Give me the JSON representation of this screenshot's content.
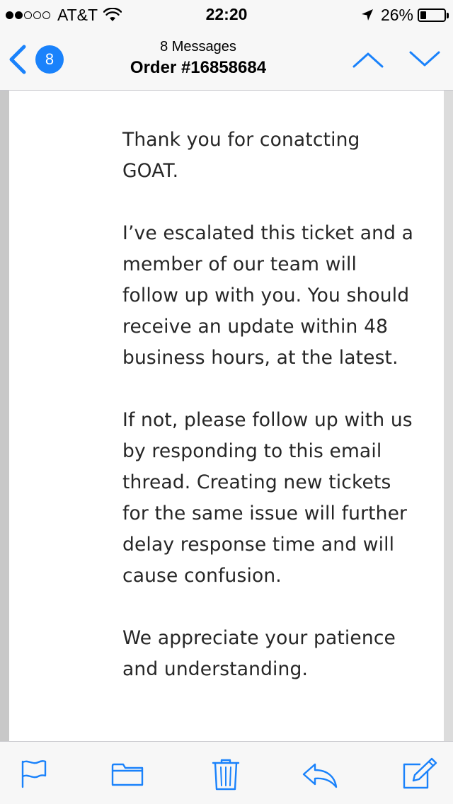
{
  "status_bar": {
    "signal_dots_filled": 2,
    "signal_dots_total": 5,
    "carrier": "AT&T",
    "time": "22:20",
    "battery_percent": "26%",
    "battery_level": 0.26
  },
  "nav": {
    "back_badge": "8",
    "subtitle": "8 Messages",
    "title": "Order #16858684",
    "accent_color": "#1a82fb"
  },
  "email": {
    "paragraphs": [
      [
        "Thank you for conatcting",
        "GOAT."
      ],
      [
        "I’ve escalated this ticket and a",
        "member of our team will",
        "follow up with you. You should",
        "receive an update within 48",
        "business hours, at the latest."
      ],
      [
        "If not, please follow up with us",
        "by responding to this email",
        "thread. Creating new tickets",
        "for the same issue will further",
        "delay response time and will",
        "cause confusion."
      ],
      [
        "We appreciate your patience",
        "and understanding."
      ]
    ]
  },
  "toolbar": {
    "items": [
      {
        "name": "flag-icon"
      },
      {
        "name": "folder-icon"
      },
      {
        "name": "trash-icon"
      },
      {
        "name": "reply-icon"
      },
      {
        "name": "compose-icon"
      }
    ]
  }
}
